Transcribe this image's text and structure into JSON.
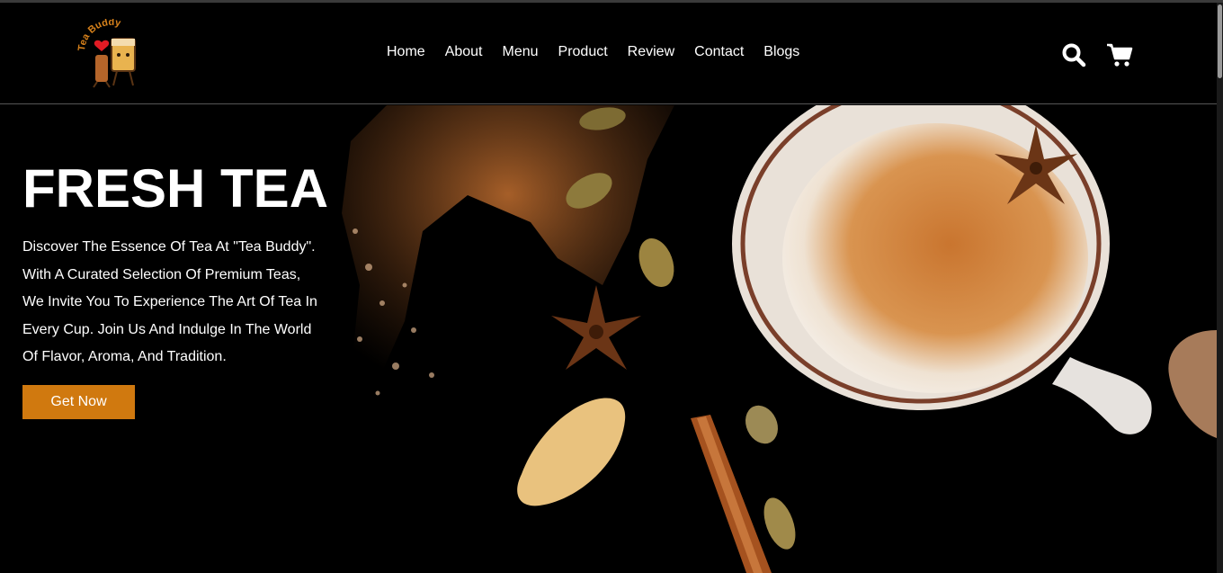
{
  "brand": {
    "logo_text": "Tea Buddy"
  },
  "nav": {
    "items": [
      "Home",
      "About",
      "Menu",
      "Product",
      "Review",
      "Contact",
      "Blogs"
    ]
  },
  "header_icons": {
    "search": "search-icon",
    "cart": "cart-icon"
  },
  "hero": {
    "title": "FRESH TEA",
    "description_lines": [
      "Discover The Essence Of Tea At \"Tea Buddy\".",
      "With A Curated Selection Of Premium Teas,",
      "We Invite You To Experience The Art Of Tea In",
      "Every Cup. Join Us And Indulge In The World",
      "Of Flavor, Aroma, And Tradition."
    ],
    "cta_label": "Get Now"
  },
  "colors": {
    "accent": "#d0790f",
    "background": "#000000",
    "text": "#ffffff"
  }
}
